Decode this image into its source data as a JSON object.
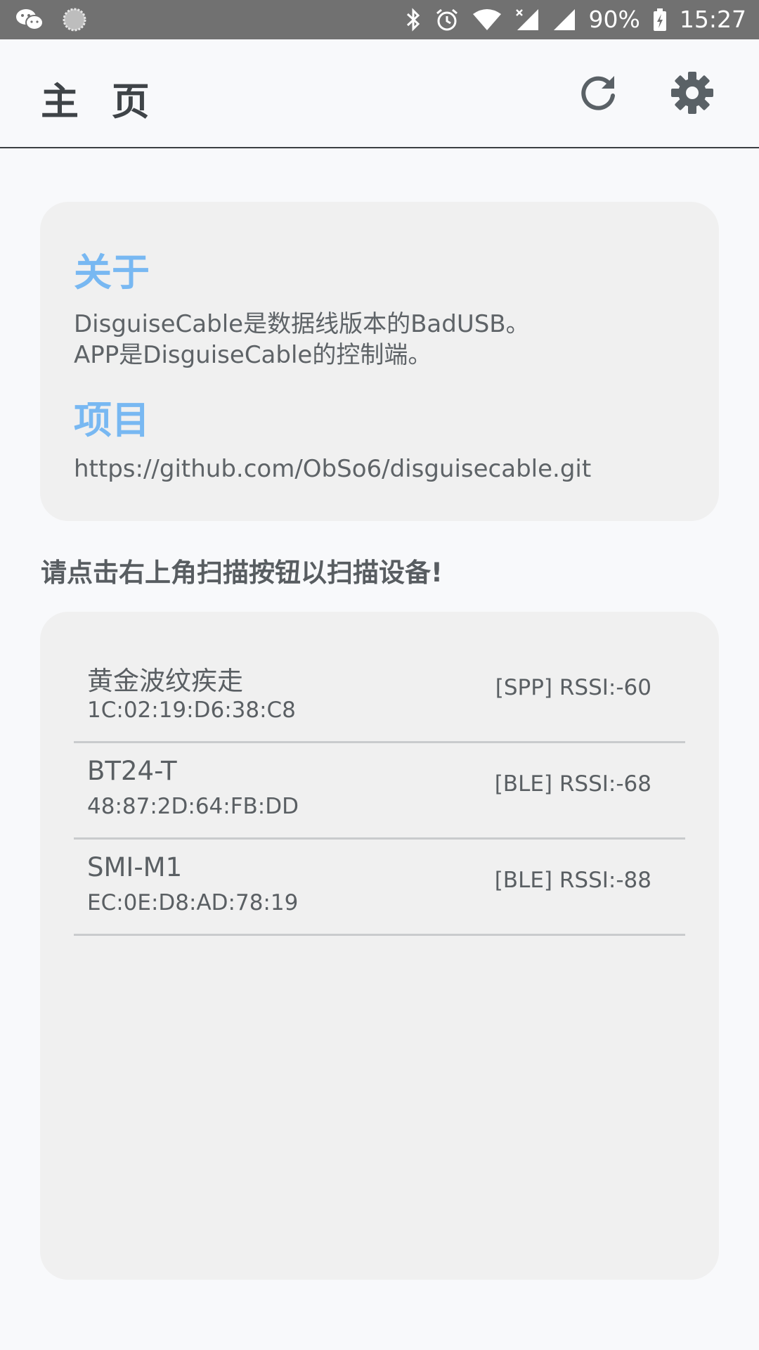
{
  "status_bar": {
    "left_icons": [
      "wechat-icon",
      "loading-icon"
    ],
    "right_icons": [
      "bluetooth-icon",
      "alarm-icon",
      "wifi-icon",
      "signal-no-sim-icon",
      "signal-icon",
      "battery-charging-icon"
    ],
    "battery": "90%",
    "time": "15:27"
  },
  "app_bar": {
    "title": "主 页",
    "refresh_icon": "refresh-icon",
    "settings_icon": "gear-icon"
  },
  "about_card": {
    "about_title": "关于",
    "about_lines": [
      "DisguiseCable是数据线版本的BadUSB。",
      "APP是DisguiseCable的控制端。"
    ],
    "project_title": "项目",
    "project_link": "https://github.com/ObSo6/disguisecable.git"
  },
  "scan_hint": "请点击右上角扫描按钮以扫描设备!",
  "devices": [
    {
      "name": "黄金波纹疾走",
      "mac": "1C:02:19:D6:38:C8",
      "signal": "[SPP] RSSI:-60"
    },
    {
      "name": "BT24-T",
      "mac": "48:87:2D:64:FB:DD",
      "signal": "[BLE] RSSI:-68"
    },
    {
      "name": "SMI-M1",
      "mac": "EC:0E:D8:AD:78:19",
      "signal": "[BLE] RSSI:-88"
    }
  ],
  "colors": {
    "status_bar": "#717171",
    "background": "#f8f9fb",
    "card": "#f0f0f0",
    "accent": "#78b8f2",
    "text": "#5a5f63"
  }
}
